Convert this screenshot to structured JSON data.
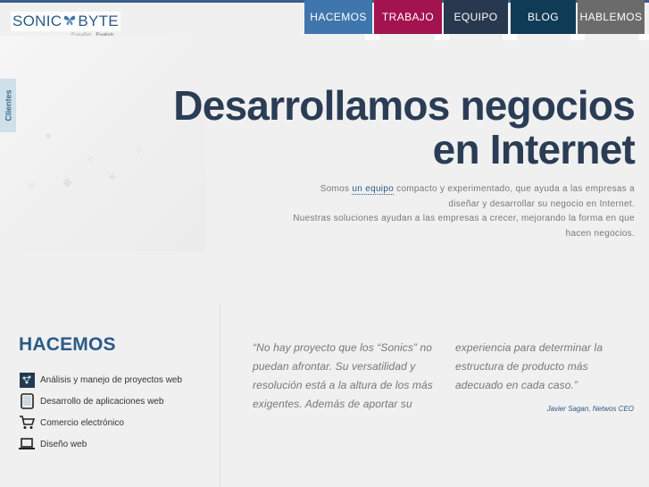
{
  "logo": {
    "left": "SONIC",
    "right": "BYTE"
  },
  "languages": [
    "Español",
    "English"
  ],
  "nav": [
    {
      "label": "HACEMOS",
      "color": "#3f76ad"
    },
    {
      "label": "TRABAJO",
      "color": "#a3134f"
    },
    {
      "label": "EQUIPO",
      "color": "#27384f"
    },
    {
      "label": "BLOG",
      "color": "#0f3b57"
    },
    {
      "label": "HABLEMOS",
      "color": "#6b6b6b"
    }
  ],
  "sidebar_tab": "Clientes",
  "hero": {
    "headline_line1": "Desarrollamos negocios",
    "headline_line2": "en Internet",
    "intro_pre": "Somos ",
    "intro_link": "un equipo",
    "intro_post": " compacto y experimentado, que ayuda a las empresas a diseñar y desarrollar su negocio en Internet.",
    "intro_line2": "Nuestras soluciones ayudan a las empresas a crecer, mejorando la forma en que hacen negocios."
  },
  "hacemos": {
    "title": "HACEMOS",
    "items": [
      {
        "label": "Análisis y manejo de proyectos web",
        "icon": "analysis-icon"
      },
      {
        "label": "Desarrollo de aplicaciones web",
        "icon": "tablet-icon"
      },
      {
        "label": "Comercio electrónico",
        "icon": "cart-icon"
      },
      {
        "label": "Diseño web",
        "icon": "laptop-icon"
      }
    ]
  },
  "testimonial": {
    "col1": "“No hay proyecto que los “Sonics” no puedan afrontar. Su versatilidad y resolución está a la altura de los más exigentes. Además de aportar su",
    "col2": "experiencia para determinar la estructura de producto más adecuado en cada caso.”",
    "author": "Javier Sagan, Netwos CEO"
  }
}
